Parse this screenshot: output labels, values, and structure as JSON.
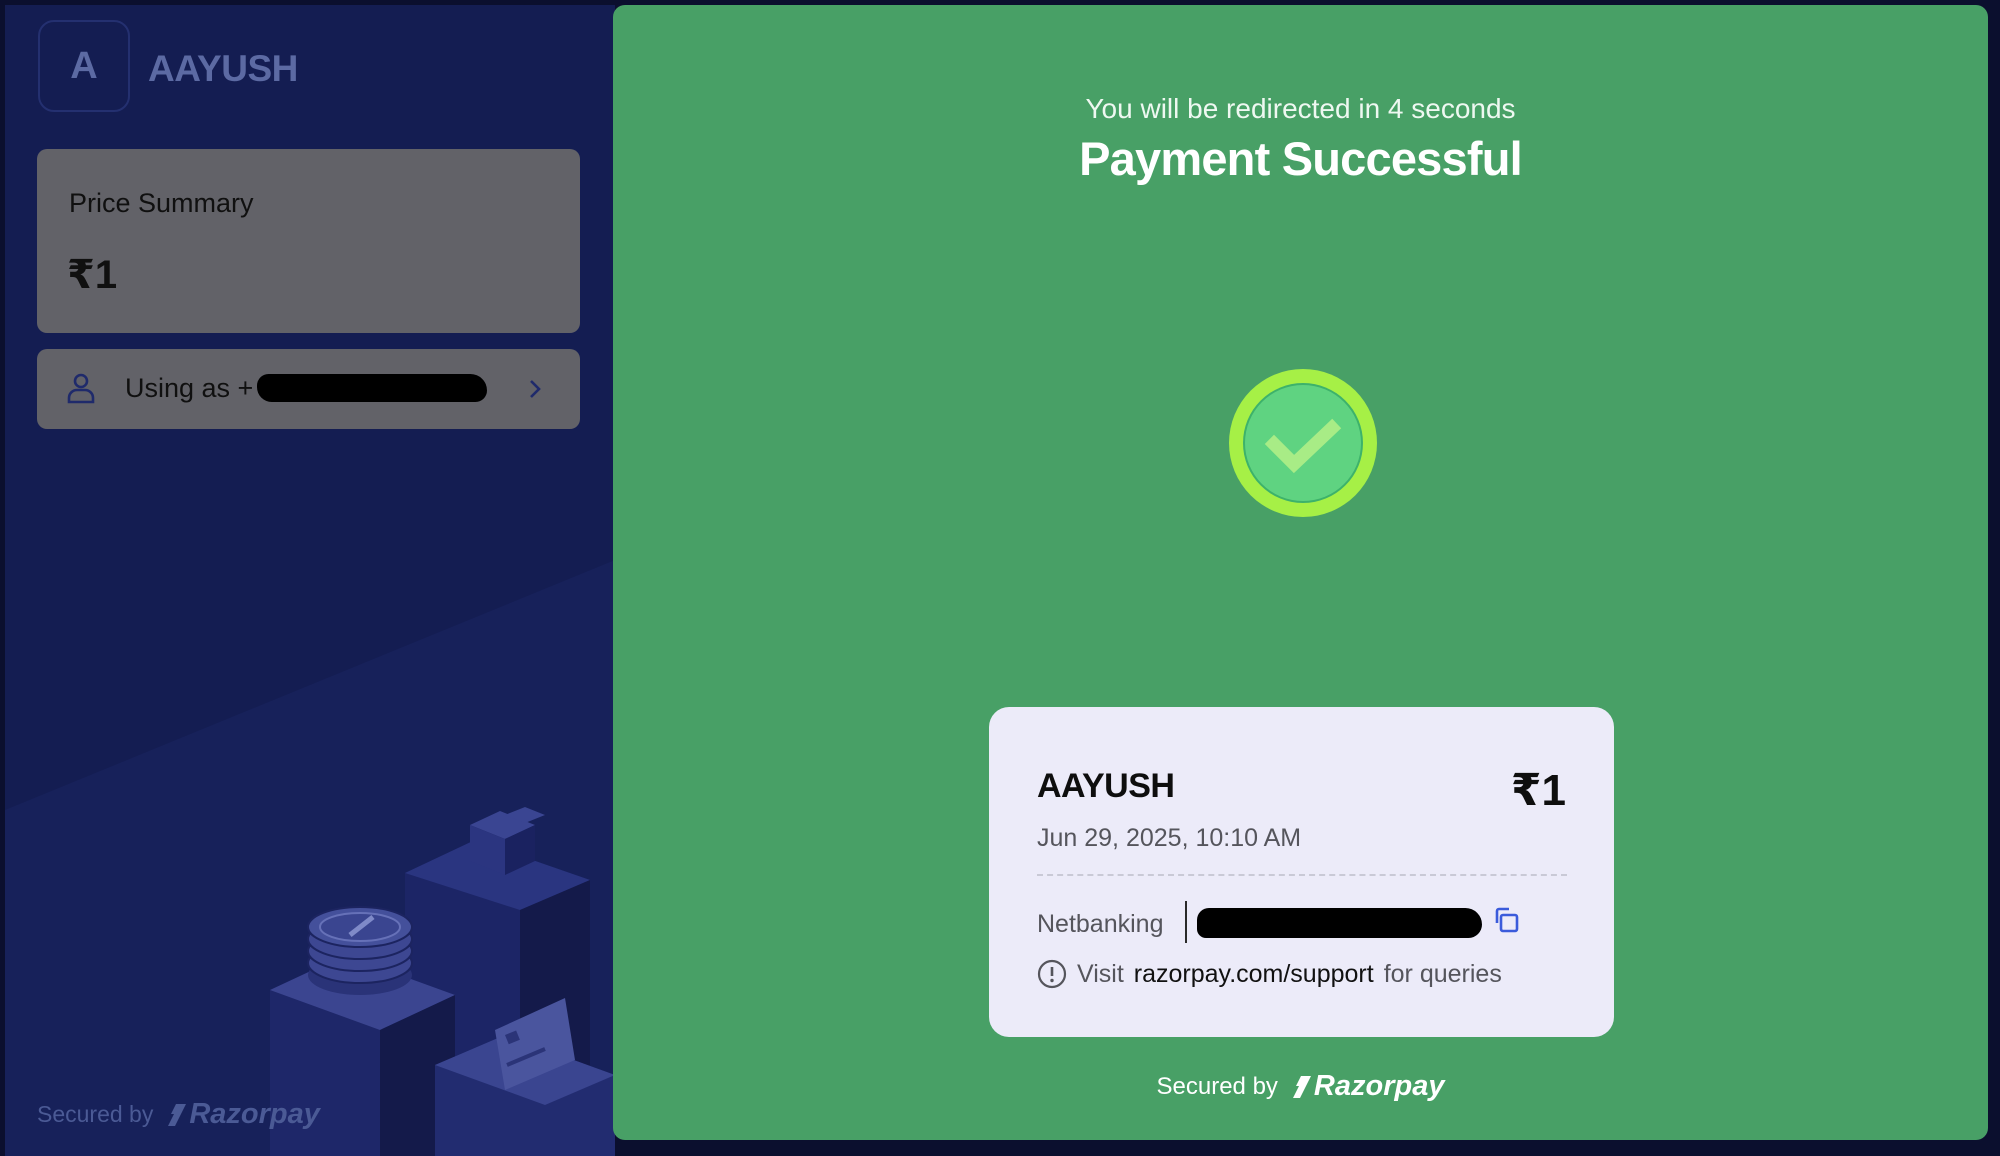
{
  "merchant": {
    "initial": "A",
    "name": "AAYUSH"
  },
  "price_summary": {
    "label": "Price Summary",
    "amount": "₹1"
  },
  "user": {
    "label": "Using as +"
  },
  "footer": {
    "secured_by": "Secured by",
    "brand": "Razorpay"
  },
  "status": {
    "redirect_text": "You will be redirected in 4 seconds",
    "title": "Payment Successful"
  },
  "receipt": {
    "merchant": "AAYUSH",
    "amount": "₹1",
    "date": "Jun 29, 2025, 10:10 AM",
    "method": "Netbanking",
    "info_prefix": "Visit",
    "info_link": "razorpay.com/support",
    "info_suffix": "for queries"
  },
  "colors": {
    "success_bg": "#48a066",
    "left_bg": "#141d52",
    "check_ring": "#a6f046",
    "receipt_bg": "#ecebf9",
    "copy_icon": "#3b5bdb"
  },
  "icons": [
    "user-icon",
    "chevron-right-icon",
    "check-icon",
    "copy-icon",
    "info-icon",
    "razorpay-logo-icon"
  ]
}
